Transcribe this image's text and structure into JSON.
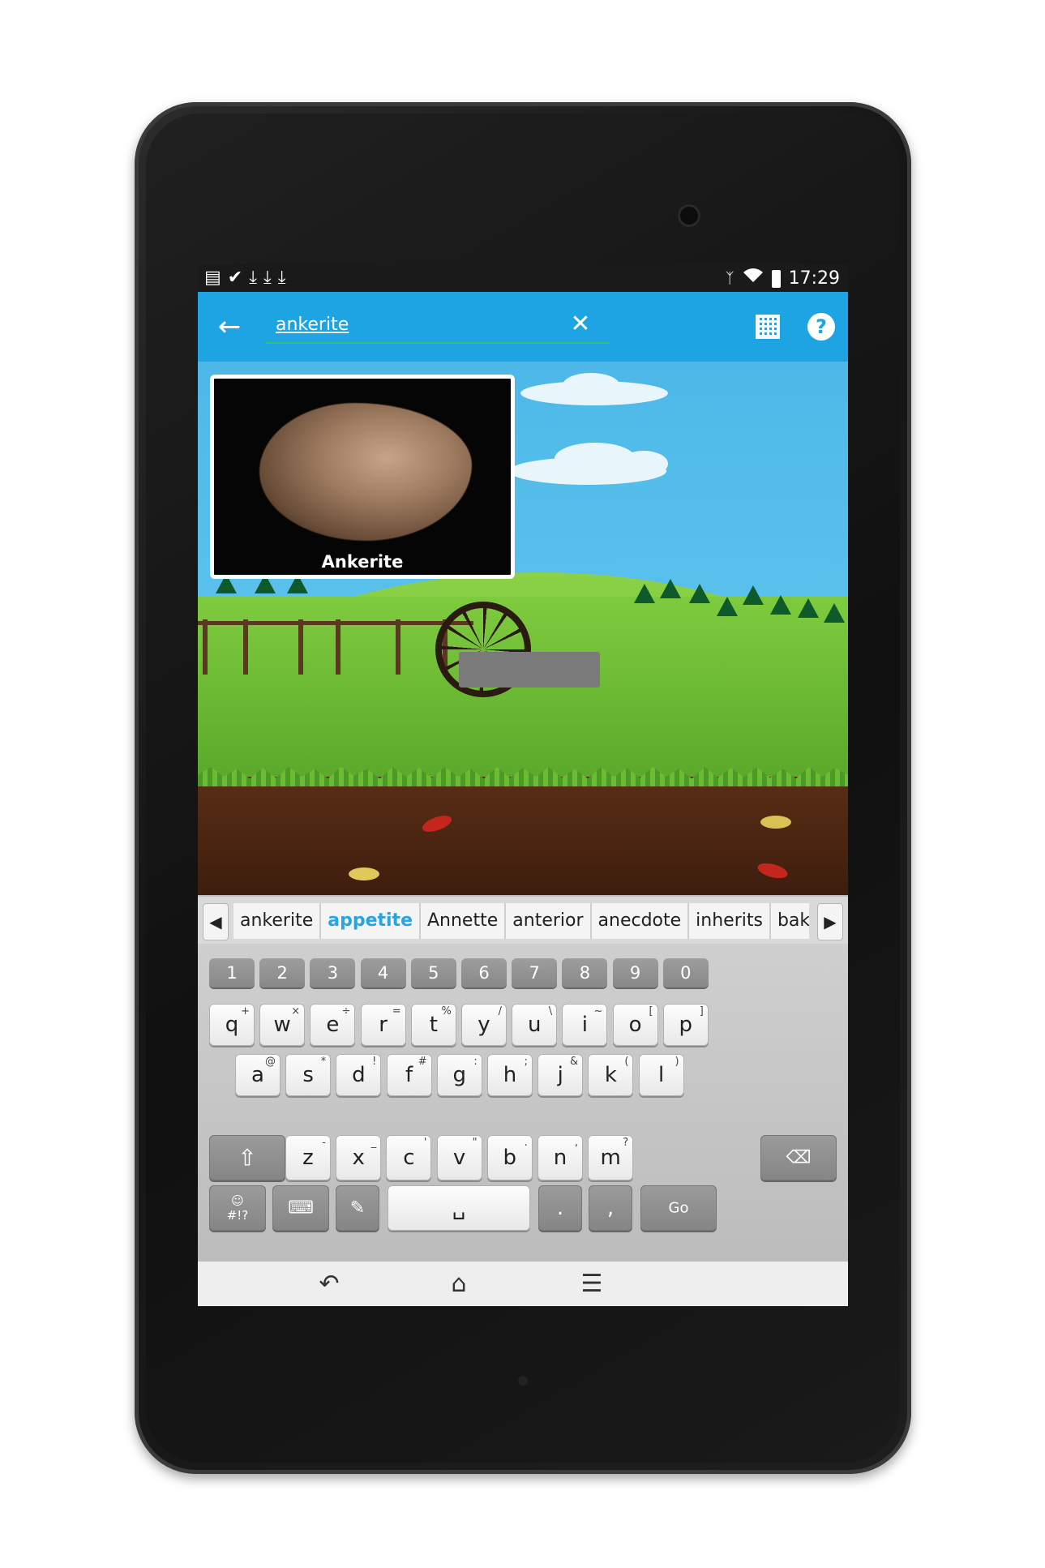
{
  "status_bar": {
    "notification_icons": [
      "image-icon",
      "check-icon",
      "download-icon",
      "download-icon",
      "download-icon"
    ],
    "time": "17:29"
  },
  "app_bar": {
    "search_value": "ankerite",
    "accent_color": "#1ea3e3"
  },
  "result_card": {
    "label": "Ankerite"
  },
  "suggestions": [
    "ankerite",
    "appetite",
    "Annette",
    "anterior",
    "anecdote",
    "inherits",
    "bakerie"
  ],
  "suggestion_active_index": 1,
  "keyboard": {
    "numbers": [
      "1",
      "2",
      "3",
      "4",
      "5",
      "6",
      "7",
      "8",
      "9",
      "0"
    ],
    "row1": [
      {
        "k": "q",
        "a": "+"
      },
      {
        "k": "w",
        "a": "×"
      },
      {
        "k": "e",
        "a": "÷"
      },
      {
        "k": "r",
        "a": "="
      },
      {
        "k": "t",
        "a": "%"
      },
      {
        "k": "y",
        "a": "/"
      },
      {
        "k": "u",
        "a": "\\"
      },
      {
        "k": "i",
        "a": "~"
      },
      {
        "k": "o",
        "a": "["
      },
      {
        "k": "p",
        "a": "]"
      }
    ],
    "row2": [
      {
        "k": "a",
        "a": "@"
      },
      {
        "k": "s",
        "a": "*"
      },
      {
        "k": "d",
        "a": "!"
      },
      {
        "k": "f",
        "a": "#"
      },
      {
        "k": "g",
        "a": ":"
      },
      {
        "k": "h",
        "a": ";"
      },
      {
        "k": "j",
        "a": "&"
      },
      {
        "k": "k",
        "a": "("
      },
      {
        "k": "l",
        "a": ")"
      }
    ],
    "row3": [
      {
        "k": "z",
        "a": "-"
      },
      {
        "k": "x",
        "a": "_"
      },
      {
        "k": "c",
        "a": "'"
      },
      {
        "k": "v",
        "a": "\""
      },
      {
        "k": "b",
        "a": "."
      },
      {
        "k": "n",
        "a": ","
      },
      {
        "k": "m",
        "a": "?"
      }
    ],
    "symbols_label": "#!?",
    "period": ".",
    "comma": ",",
    "go_label": "Go"
  }
}
